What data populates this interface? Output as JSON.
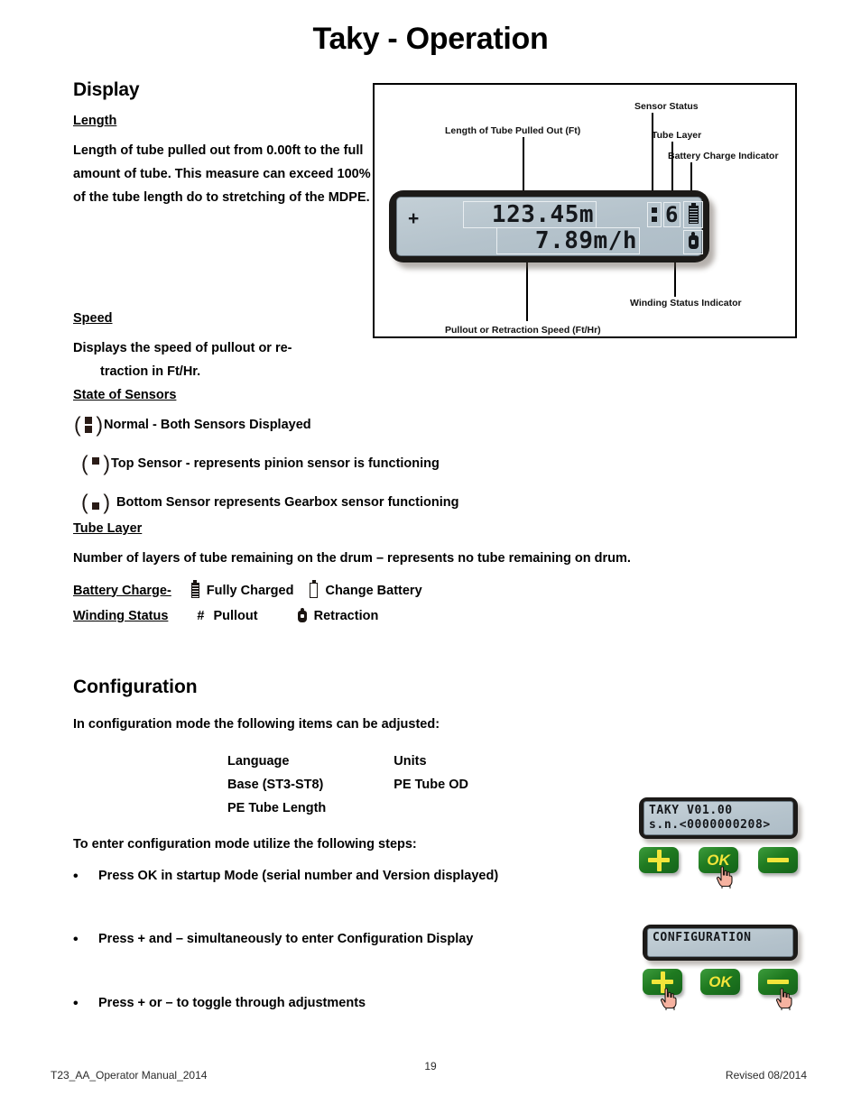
{
  "page": {
    "title": "Taky - Operation"
  },
  "display_section": {
    "heading": "Display",
    "length_head": "Length",
    "length_body": "Length  of tube pulled out from 0.00ft to the full amount of tube.  This measure can exceed 100% of the tube length do to stretching of the MDPE.",
    "speed_head": "Speed",
    "speed_body": "Displays the speed of pullout or re-",
    "speed_body_2": "traction in Ft/Hr.",
    "sensors_head": "State of Sensors",
    "sensor_states": [
      {
        "icon": "sensor-both-icon",
        "label": "Normal - Both Sensors Displayed"
      },
      {
        "icon": "sensor-top-icon",
        "label": "Top Sensor - represents pinion sensor is functioning"
      },
      {
        "icon": "sensor-bottom-icon",
        "label": "Bottom Sensor represents Gearbox sensor functioning"
      }
    ],
    "tube_layer_head": "Tube Layer",
    "tube_layer_body": "Number of layers of tube remaining on the drum –  represents no tube remaining on drum.",
    "battery_head": "Battery Charge-",
    "battery_full_label": "Fully Charged",
    "battery_empty_label": "Change Battery",
    "winding_head": "Winding Status",
    "winding_pullout_glyph": "#",
    "winding_pullout_label": "Pullout",
    "winding_retraction_label": "Retraction"
  },
  "diagram": {
    "labels": {
      "length": "Length of Tube Pulled Out (Ft)",
      "sensor_status": "Sensor Status",
      "tube_layer": "Tube Layer",
      "battery": "Battery Charge Indicator",
      "winding": "Winding Status Indicator",
      "speed": "Pullout or Retraction Speed (Ft/Hr)"
    },
    "lcd": {
      "sign": "+",
      "length_value": "123.45m",
      "speed_value": "7.89m/h",
      "tube_layer_value": "6"
    }
  },
  "configuration": {
    "heading": "Configuration",
    "intro": "In configuration mode the following items can be adjusted:",
    "items": [
      [
        "Language",
        "Units"
      ],
      [
        "Base (ST3-ST8)",
        "PE Tube OD"
      ],
      [
        "PE Tube Length",
        ""
      ]
    ],
    "steps_intro": "To enter configuration mode utilize the following steps:",
    "bullet_char": "•",
    "steps": [
      "Press OK in startup Mode (serial number and Version displayed)",
      "Press + and – simultaneously to enter Configuration Display",
      "Press + or – to toggle through adjustments"
    ],
    "panel_startup": {
      "line1": "TAKY V01.00",
      "line2": "s.n.<0000000208>",
      "plus_label": "+",
      "ok_label": "OK",
      "minus_label": "–"
    },
    "panel_config": {
      "line1": "CONFIGURATION",
      "plus_label": "+",
      "ok_label": "OK",
      "minus_label": "–"
    }
  },
  "footer": {
    "left": "T23_AA_Operator Manual_2014",
    "page": "19",
    "right": "Revised 08/2014"
  },
  "colors": {
    "key_green": "#1f7a20",
    "key_yellow": "#f2e53a",
    "lcd_bg": "#b4c2cb",
    "bezel": "#1c1a18"
  }
}
